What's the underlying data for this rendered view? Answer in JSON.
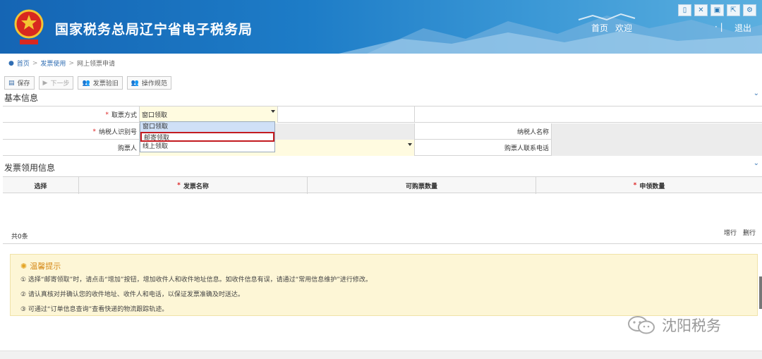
{
  "header": {
    "title": "国家税务总局辽宁省电子税务局",
    "home": "首页",
    "welcome": "欢迎",
    "separator": "·  |",
    "logout": "退出",
    "tool_icons": [
      "mobile-icon",
      "fullscreen-icon",
      "print-icon",
      "export-icon",
      "settings-icon"
    ]
  },
  "breadcrumb": [
    "首页",
    "发票使用",
    "网上领票申请"
  ],
  "toolbar": {
    "save": "保存",
    "next": "下一步",
    "verify": "发票验旧",
    "guide": "操作规范"
  },
  "basic_info": {
    "title": "基本信息",
    "pickup_label": "取票方式",
    "pickup_value": "窗口领取",
    "taxpayer_id_label": "纳税人识别号",
    "taxpayer_name_label": "纳税人名称",
    "buyer_label": "购票人",
    "buyer_phone_label": "购票人联系电话",
    "dropdown_options": [
      "窗口领取",
      "邮寄领取",
      "线上领取"
    ]
  },
  "invoice": {
    "title": "发票领用信息",
    "columns": [
      "选择",
      "发票名称",
      "可购票数量",
      "申领数量"
    ],
    "total": "共0条",
    "add_row": "增行",
    "delete_row": "删行"
  },
  "tips": {
    "title": "温馨提示",
    "items": [
      "① 选择“邮寄领取”时，请点击“增加”按钮，增加收件人和收件地址信息。如收件信息有误，请通过“常用信息维护”进行修改。",
      "② 请认真核对并确认您的收件地址、收件人和电话，以保证发票准确及时送达。",
      "③ 可通过“订单信息查询”查看快递的物流跟踪轨迹。"
    ]
  },
  "watermark": "沈阳税务",
  "colors": {
    "header_blue": "#1d7cc7",
    "link_blue": "#2f6db3",
    "required_red": "#d22222",
    "highlight_red": "#c31b20",
    "tip_bg": "#fdf6d6"
  }
}
